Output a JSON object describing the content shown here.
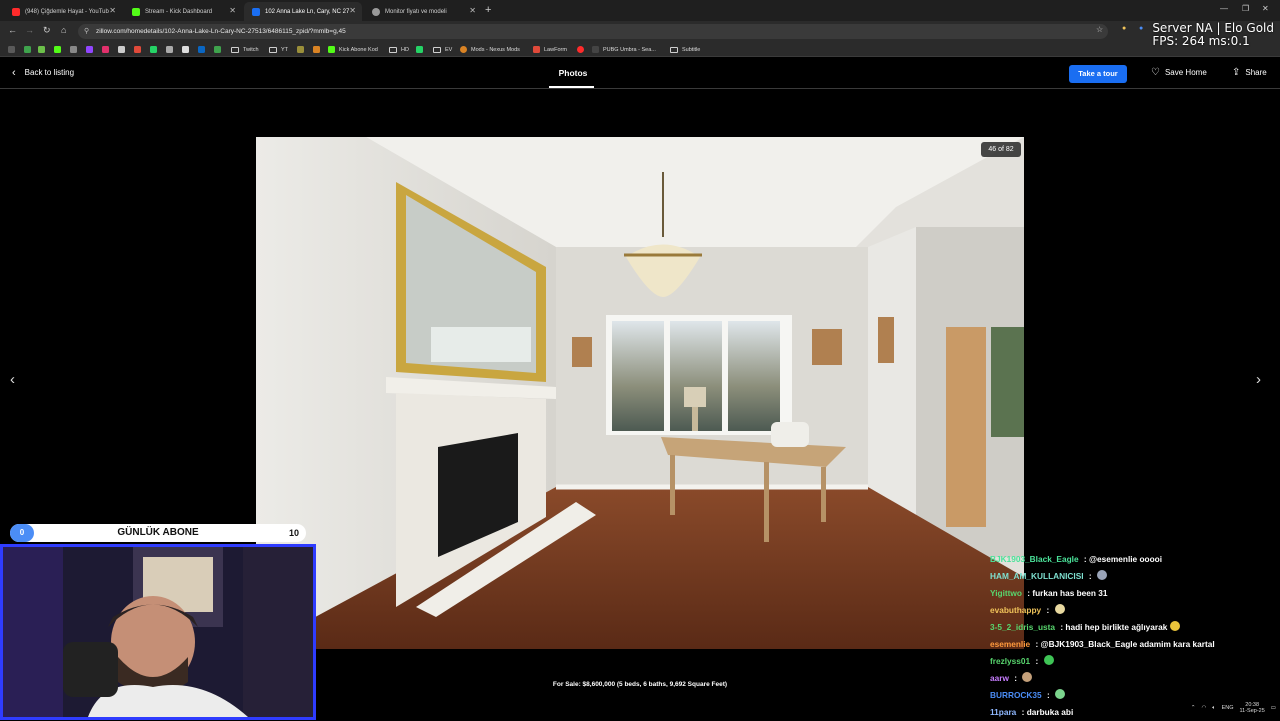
{
  "browser": {
    "tabs": [
      {
        "title": "(948) Çiğdemle Hayat - YouTub",
        "favicon_color": "#ff2b2b"
      },
      {
        "title": "Stream - Kick Dashboard",
        "favicon_color": "#53fc18"
      },
      {
        "title": "102 Anna Lake Ln, Cary, NC 27",
        "favicon_color": "#1a6ef2"
      },
      {
        "title": "Monitor fiyatı ve modeli",
        "favicon_color": "#9a9a9a"
      }
    ],
    "url": "zillow.com/homedetails/102-Anna-Lake-Ln-Cary-NC-27513/6486115_zpid/?mmlb=g,45",
    "bookmarks": [
      {
        "label": "Twitch",
        "type": "folder"
      },
      {
        "label": "YT",
        "type": "folder"
      },
      {
        "label": "Kick Abone Kod",
        "type": "link",
        "color": "#53fc18"
      },
      {
        "label": "HD",
        "type": "folder"
      },
      {
        "label": "EV",
        "type": "folder"
      },
      {
        "label": "Mods - Nexus Mods",
        "type": "link",
        "color": "#d98324"
      },
      {
        "label": "LawForm",
        "type": "link",
        "color": "#e04a3a"
      },
      {
        "label": "PUBG Umbra - Sea...",
        "type": "link",
        "color": "#ff2b2b"
      },
      {
        "label": "Subtitle",
        "type": "folder"
      }
    ]
  },
  "overlay": {
    "server": "Server NA | Elo Gold",
    "fps": "FPS: 264 ms:0.1"
  },
  "viewer": {
    "back_label": "Back to listing",
    "tab_label": "Photos",
    "tour_label": "Take a tour",
    "save_label": "Save Home",
    "share_label": "Share",
    "counter": "46 of 82",
    "caption": "For Sale: $8,600,000 (5 beds, 6 baths, 9,692 Square Feet)"
  },
  "stream": {
    "sub_goal": {
      "current": "0",
      "title": "GÜNLÜK ABONE",
      "target": "10"
    },
    "chat": [
      {
        "user": "BJK1903_Black_Eagle",
        "sep": " :",
        "msg": "@esemenlie ooooi",
        "color": "#4be39a"
      },
      {
        "user": "HAM_AM_KULLANICISI",
        "sep": " :",
        "msg": "",
        "color": "#7ee0d0",
        "emoji": "#9aa4b8"
      },
      {
        "user": "Yigittwo",
        "sep": " :",
        "msg": "furkan has been 31",
        "color": "#58d66e"
      },
      {
        "user": "evabuthappy",
        "sep": " :",
        "msg": "",
        "color": "#f0c35a",
        "emoji": "#e8d9a0"
      },
      {
        "user": "3-5_2_idris_usta",
        "sep": " :",
        "msg": "hadi hep birlikte ağlıyarak",
        "color": "#58d66e",
        "emoji": "#e9c33b"
      },
      {
        "user": "esemenlie",
        "sep": " :",
        "msg": "@BJK1903_Black_Eagle adamim kara kartal",
        "color": "#ff9a3d"
      },
      {
        "user": "frezlyss01",
        "sep": " :",
        "msg": "",
        "color": "#58d66e",
        "emoji": "#3fc456"
      },
      {
        "user": "aarw",
        "sep": " :",
        "msg": "",
        "color": "#c77dff",
        "emoji": "#c4a07a"
      },
      {
        "user": "BURROCK35",
        "sep": " :",
        "msg": "",
        "color": "#4b8df6",
        "emoji": "#7bd48d"
      },
      {
        "user": "11para",
        "sep": " :",
        "msg": "darbuka abi",
        "color": "#8fb8ff"
      }
    ]
  },
  "taskbar": {
    "lang": "ENG",
    "time": "20:38",
    "date": "11-Sep-25"
  }
}
